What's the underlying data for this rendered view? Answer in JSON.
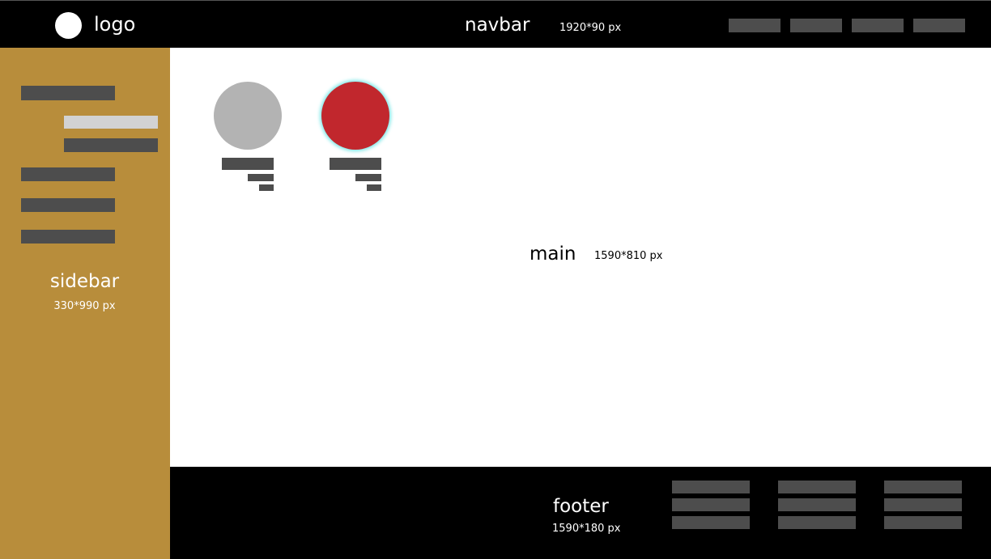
{
  "navbar": {
    "logo_label": "logo",
    "title": "navbar",
    "size": "1920*90 px",
    "links": [
      "",
      "",
      "",
      ""
    ]
  },
  "sidebar": {
    "title": "sidebar",
    "size": "330*990 px",
    "items": [
      {
        "active": false
      },
      {
        "active": true
      },
      {
        "active": false
      },
      {
        "active": false
      },
      {
        "active": false
      },
      {
        "active": false
      }
    ]
  },
  "main": {
    "title": "main",
    "size": "1590*810 px",
    "cards": [
      {
        "state": "default",
        "color": "#b3b3b3"
      },
      {
        "state": "selected",
        "color": "#c1272d",
        "glow": "#7fe8e8"
      }
    ]
  },
  "footer": {
    "title": "footer",
    "size": "1590*180 px"
  },
  "colors": {
    "navbar_bg": "#000000",
    "sidebar_bg": "#b88d3b",
    "main_bg": "#ffffff",
    "footer_bg": "#000000",
    "placeholder_bar": "#4d4d4d",
    "active_bar": "#d2d2d2"
  }
}
